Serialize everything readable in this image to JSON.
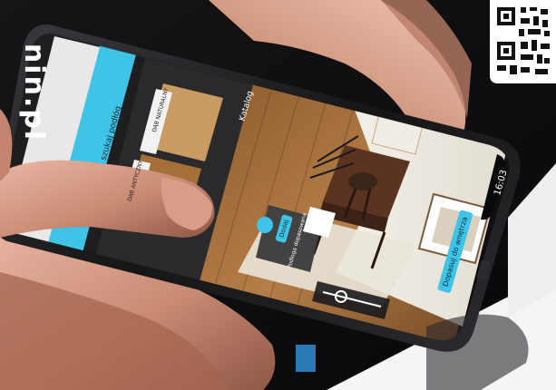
{
  "brand": {
    "text": "nin.pl"
  },
  "phone": {
    "status": {
      "time": "16:03"
    },
    "toolbar": {
      "label": "Katalog"
    },
    "search": {
      "placeholder": "szukaj podłóg"
    },
    "catalog": {
      "tile_1": "DĄB NATURALNY",
      "tile_2": "DĄB ANTYCZNY"
    },
    "ar": {
      "cta_primary": "Dopasuj do wnętrza",
      "cta_secondary": "Dodaj",
      "tooltip": "Podłoga dopasowana"
    }
  },
  "colors": {
    "background": "#0b0b0c",
    "accent_cyan": "#3fc3e6",
    "floor_wood": "#a8733f",
    "phone_frame": "#1a1a1c",
    "red_accent": "#c43a2a",
    "blue_accent": "#2a78b4"
  }
}
